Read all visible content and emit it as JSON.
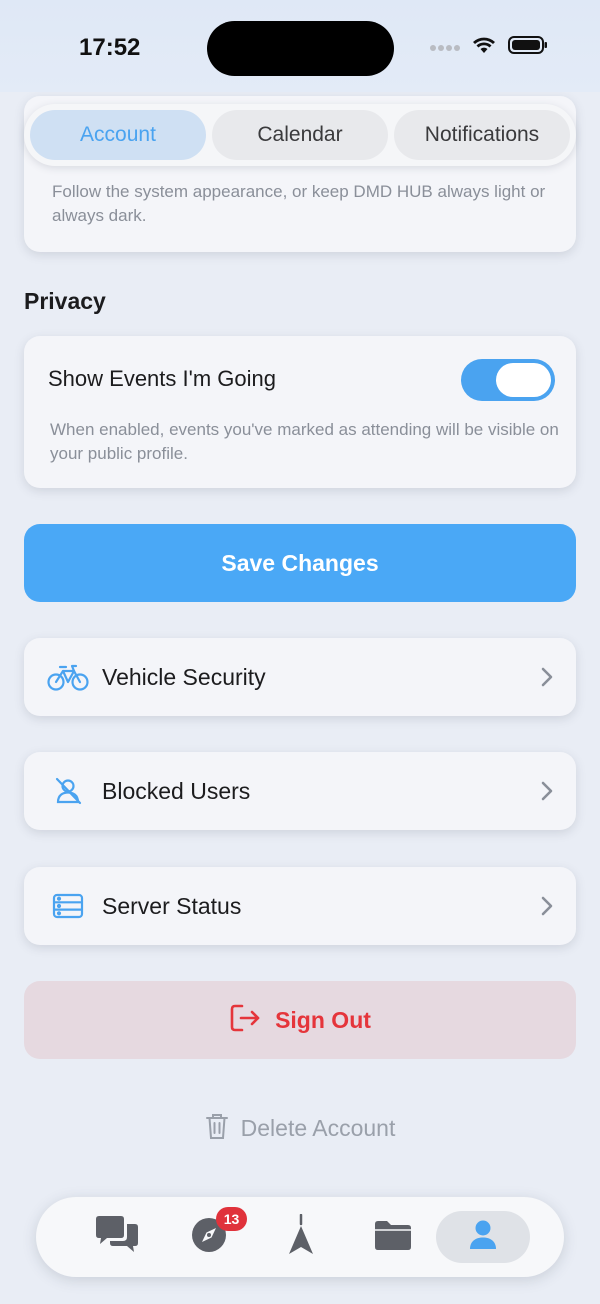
{
  "status_bar": {
    "time": "17:52"
  },
  "tabs": [
    {
      "label": "Account",
      "active": true
    },
    {
      "label": "Calendar",
      "active": false
    },
    {
      "label": "Notifications",
      "active": false
    }
  ],
  "appearance": {
    "description": "Follow the system appearance, or keep DMD HUB always light or always dark."
  },
  "privacy": {
    "section_title": "Privacy",
    "toggle_label": "Show Events I'm Going",
    "toggle_on": true,
    "description": "When enabled, events you've marked as attending will be visible on your public profile."
  },
  "save_button": "Save Changes",
  "nav_items": [
    {
      "label": "Vehicle Security",
      "icon": "bicycle-icon"
    },
    {
      "label": "Blocked Users",
      "icon": "blocked-user-icon"
    },
    {
      "label": "Server Status",
      "icon": "server-icon"
    }
  ],
  "sign_out": "Sign Out",
  "delete_account": "Delete Account",
  "tab_bar": {
    "items": [
      {
        "icon": "chat-bubbles-icon",
        "active": false
      },
      {
        "icon": "compass-icon",
        "active": false,
        "badge": "13"
      },
      {
        "icon": "navigation-arrow-icon",
        "active": false
      },
      {
        "icon": "folder-icon",
        "active": false
      },
      {
        "icon": "person-icon",
        "active": true
      }
    ]
  },
  "colors": {
    "accent": "#4aa8f6",
    "danger": "#e5353b",
    "badge": "#e0323b",
    "background": "#e9edf5"
  }
}
